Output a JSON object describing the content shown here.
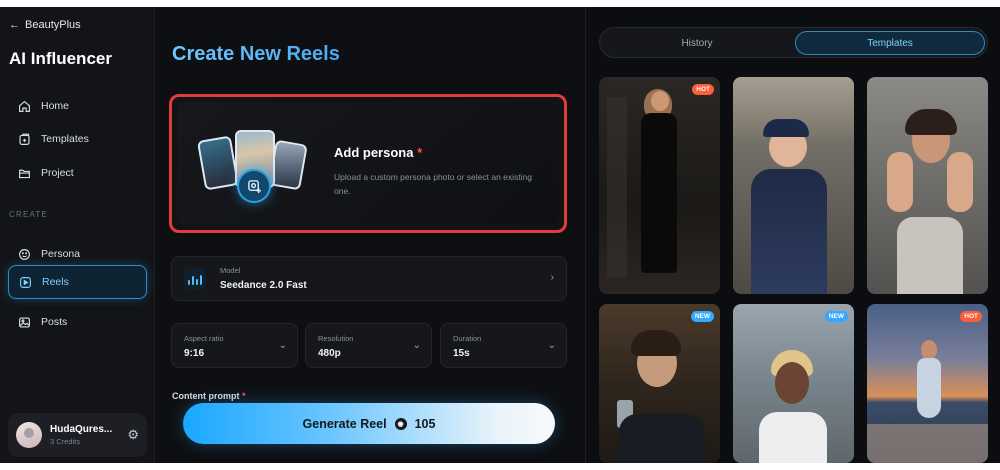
{
  "sidebar": {
    "back_label": "BeautyPlus",
    "app_title": "AI Influencer",
    "nav_top": [
      {
        "label": "Home",
        "icon": "home-icon"
      },
      {
        "label": "Templates",
        "icon": "templates-icon"
      },
      {
        "label": "Project",
        "icon": "folder-icon"
      }
    ],
    "section_label": "CREATE",
    "nav_create": [
      {
        "label": "Persona",
        "icon": "smile-icon"
      },
      {
        "label": "Reels",
        "icon": "reels-icon",
        "active": true
      },
      {
        "label": "Posts",
        "icon": "image-icon"
      }
    ],
    "user": {
      "name": "HudaQures...",
      "credits": "3 Credits"
    }
  },
  "main": {
    "title": "Create New Reels",
    "persona": {
      "title": "Add persona",
      "required_mark": "*",
      "description": "Upload a custom persona photo or select an existing one."
    },
    "model": {
      "label": "Model",
      "value": "Seedance 2.0 Fast"
    },
    "settings": [
      {
        "label": "Aspect ratio",
        "value": "9:16"
      },
      {
        "label": "Resolution",
        "value": "480p"
      },
      {
        "label": "Duration",
        "value": "15s"
      }
    ],
    "content_prompt_label": "Content prompt",
    "generate": {
      "label": "Generate Reel",
      "cost": "105"
    }
  },
  "right": {
    "tabs": [
      {
        "label": "History",
        "active": false
      },
      {
        "label": "Templates",
        "active": true
      }
    ],
    "templates": [
      {
        "badge": "HOT",
        "badge_type": "hot",
        "scene": "woman-black-dress-mirror"
      },
      {
        "badge": "",
        "badge_type": "",
        "scene": "woman-cap-street-selfie"
      },
      {
        "badge": "",
        "badge_type": "",
        "scene": "woman-hands-nails"
      },
      {
        "badge": "NEW",
        "badge_type": "new",
        "scene": "man-hallway-mirror-selfie"
      },
      {
        "badge": "NEW",
        "badge_type": "new",
        "scene": "woman-blonde-street"
      },
      {
        "badge": "HOT",
        "badge_type": "hot",
        "scene": "woman-beach-sunset"
      }
    ]
  },
  "colors": {
    "accent": "#3aa8f0",
    "required": "#ff4d4d",
    "highlight_border": "#e23b3b",
    "hot": "#ff5c38",
    "new": "#33a9ff"
  }
}
